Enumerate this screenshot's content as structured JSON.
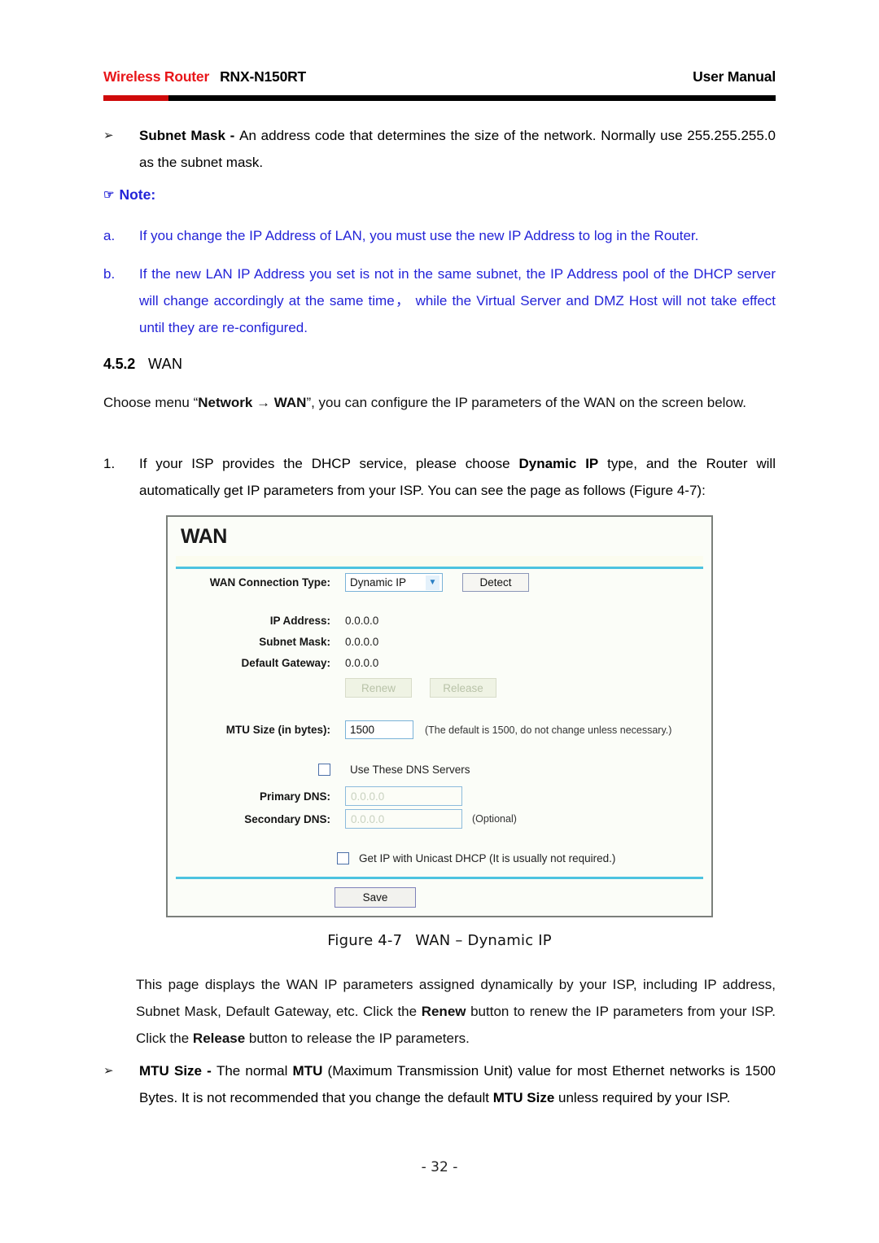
{
  "header": {
    "brand": "Wireless Router",
    "model": "RNX-N150RT",
    "right": "User Manual"
  },
  "body": {
    "subnet_bullet_marker": "➢",
    "subnet_term": "Subnet Mask - ",
    "subnet_rest": "An address code that determines the size of the network. Normally use 255.255.255.0 as the subnet mask.",
    "note_icon": "☞",
    "note_label": "Note:",
    "notes": [
      {
        "letter": "a.",
        "text": "If you change the IP Address of LAN, you must use the new IP Address to log in the Router."
      },
      {
        "letter": "b.",
        "text": "If the new LAN IP Address you set is not in the same subnet, the IP Address pool of the DHCP server will change accordingly at the same time， while the Virtual Server and DMZ Host will not take effect until they are re-configured."
      }
    ],
    "section_number": "4.5.2",
    "section_title": "WAN",
    "choose_menu_pre": "Choose menu “",
    "choose_menu_bold1": "Network",
    "choose_menu_arrow": " → ",
    "choose_menu_bold2": "WAN",
    "choose_menu_post": "”, you can configure the IP parameters of the WAN on the screen below.",
    "step1_marker": "1.",
    "step1_pre": "If your ISP provides the DHCP service, please choose ",
    "step1_bold": "Dynamic IP",
    "step1_post": " type, and the Router will automatically get IP parameters from your ISP. You can see the page as follows (Figure 4-7):",
    "desc_pre": "This page displays the WAN IP parameters assigned dynamically by your ISP, including IP address, Subnet Mask, Default Gateway, etc. Click the ",
    "desc_bold1": "Renew",
    "desc_mid": " button to renew the IP parameters from your ISP. Click the ",
    "desc_bold2": "Release",
    "desc_post": " button to release the IP parameters.",
    "mtu_bullet_marker": "➢",
    "mtu_term": "MTU Size - ",
    "mtu_pre": "The normal ",
    "mtu_bold1": "MTU",
    "mtu_mid": " (Maximum Transmission Unit) value for most Ethernet networks is 1500 Bytes. It is not recommended that you change the default ",
    "mtu_bold2": "MTU Size",
    "mtu_post": " unless required by your ISP."
  },
  "figure": {
    "panel_title": "WAN",
    "wan_connection_type_label": "WAN Connection Type:",
    "wan_connection_type_value": "Dynamic IP",
    "dropdown_arrow": "▼",
    "detect_button": "Detect",
    "ip_address_label": "IP Address:",
    "ip_address_value": "0.0.0.0",
    "subnet_mask_label": "Subnet Mask:",
    "subnet_mask_value": "0.0.0.0",
    "default_gateway_label": "Default Gateway:",
    "default_gateway_value": "0.0.0.0",
    "renew_button": "Renew",
    "release_button": "Release",
    "mtu_label": "MTU Size (in bytes):",
    "mtu_value": "1500",
    "mtu_hint": "(The default is 1500, do not change unless necessary.)",
    "use_dns_label": "Use These DNS Servers",
    "primary_dns_label": "Primary DNS:",
    "primary_dns_value": "0.0.0.0",
    "secondary_dns_label": "Secondary DNS:",
    "secondary_dns_value": "0.0.0.0",
    "secondary_dns_optional": "(Optional)",
    "unicast_dhcp_label": "Get IP with Unicast DHCP (It is usually not required.)",
    "save_button": "Save",
    "caption_figure": "Figure 4-7",
    "caption_title": "WAN – Dynamic IP"
  },
  "footer": {
    "page_number": "- 32 -"
  },
  "colors": {
    "brand_red": "#e8161a",
    "note_blue": "#2323d8",
    "panel_rule_cyan": "#4cc3e0",
    "rule_red": "#cf0a0a"
  }
}
